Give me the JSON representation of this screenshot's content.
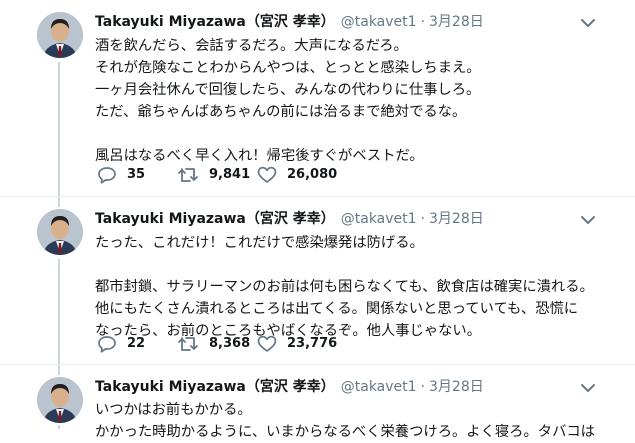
{
  "tweets": [
    {
      "name": "Takayuki Miyazawa（宮沢 孝幸）",
      "handle": "@takavet1",
      "separator": "·",
      "date": "3月28日",
      "lines": [
        "酒を飲んだら、会話するだろ。大声になるだろ。",
        "それが危険なことわからんやつは、とっとと感染しちまえ。",
        "一ヶ月会社休んで回復したら、みんなの代わりに仕事しろ。",
        "ただ、爺ちゃんばあちゃんの前には治るまで絶対でるな。",
        "",
        "風呂はなるべく早く入れ！帰宅後すぐがベストだ。"
      ],
      "replies": "35",
      "retweets": "9,841",
      "likes": "26,080"
    },
    {
      "name": "Takayuki Miyazawa（宮沢 孝幸）",
      "handle": "@takavet1",
      "separator": "·",
      "date": "3月28日",
      "lines": [
        "たった、これだけ！これだけで感染爆発は防げる。",
        "",
        "都市封鎖、サラリーマンのお前は何も困らなくても、飲食店は確実に潰れる。",
        "他にもたくさん潰れるところは出てくる。関係ないと思っていても、恐慌に",
        "なったら、お前のところもやばくなるぞ。他人事じゃない。"
      ],
      "replies": "22",
      "retweets": "8,368",
      "likes": "23,776"
    },
    {
      "name": "Takayuki Miyazawa（宮沢 孝幸）",
      "handle": "@takavet1",
      "separator": "·",
      "date": "3月28日",
      "lines": [
        "いつかはお前もかかる。",
        "かかった時助かるように、いまからなるべく栄養つけろ。よく寝ろ。タバコは"
      ]
    }
  ],
  "icons": {
    "reply": "reply-icon",
    "retweet": "retweet-icon",
    "like": "heart-icon",
    "caret": "chevron-down-icon",
    "avatar": "avatar"
  },
  "colors": {
    "text": "#14171a",
    "secondary": "#657786",
    "divider": "#e6ecf0",
    "thread_line": "#ccd6dd"
  }
}
